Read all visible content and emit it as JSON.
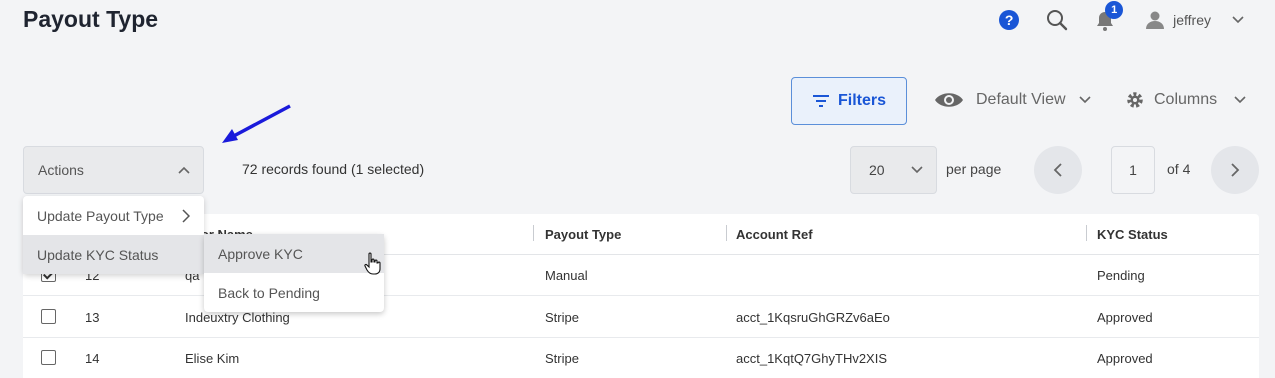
{
  "header": {
    "title": "Payout Type"
  },
  "topbar": {
    "notification_count": "1",
    "username": "jeffrey"
  },
  "toolbar": {
    "filters_label": "Filters",
    "view_label": "Default View",
    "columns_label": "Columns"
  },
  "list": {
    "actions_label": "Actions",
    "records_text": "72 records found (1 selected)",
    "per_page_value": "20",
    "per_page_label": "per page",
    "current_page": "1",
    "page_of": "of 4"
  },
  "actions_menu": {
    "items": [
      {
        "label": "Update Payout Type"
      },
      {
        "label": "Update KYC Status"
      }
    ],
    "submenu": [
      {
        "label": "Approve KYC"
      },
      {
        "label": "Back to Pending"
      }
    ]
  },
  "table": {
    "headers": {
      "vendor_name": "ndor Name",
      "payout_type": "Payout Type",
      "account_ref": "Account Ref",
      "kyc_status": "KYC Status"
    },
    "rows": [
      {
        "id": "12",
        "vendor": "qa",
        "payout_type": "Manual",
        "account_ref": "",
        "kyc_status": "Pending",
        "checked": true
      },
      {
        "id": "13",
        "vendor": "Indeuxtry Clothing",
        "payout_type": "Stripe",
        "account_ref": "acct_1KqsruGhGRZv6aEo",
        "kyc_status": "Approved",
        "checked": false
      },
      {
        "id": "14",
        "vendor": "Elise Kim",
        "payout_type": "Stripe",
        "account_ref": "acct_1KqtQ7GhyTHv2XIS",
        "kyc_status": "Approved",
        "checked": false
      }
    ]
  },
  "colors": {
    "accent": "#1a56d6",
    "annotation_arrow": "#1a1adb"
  }
}
